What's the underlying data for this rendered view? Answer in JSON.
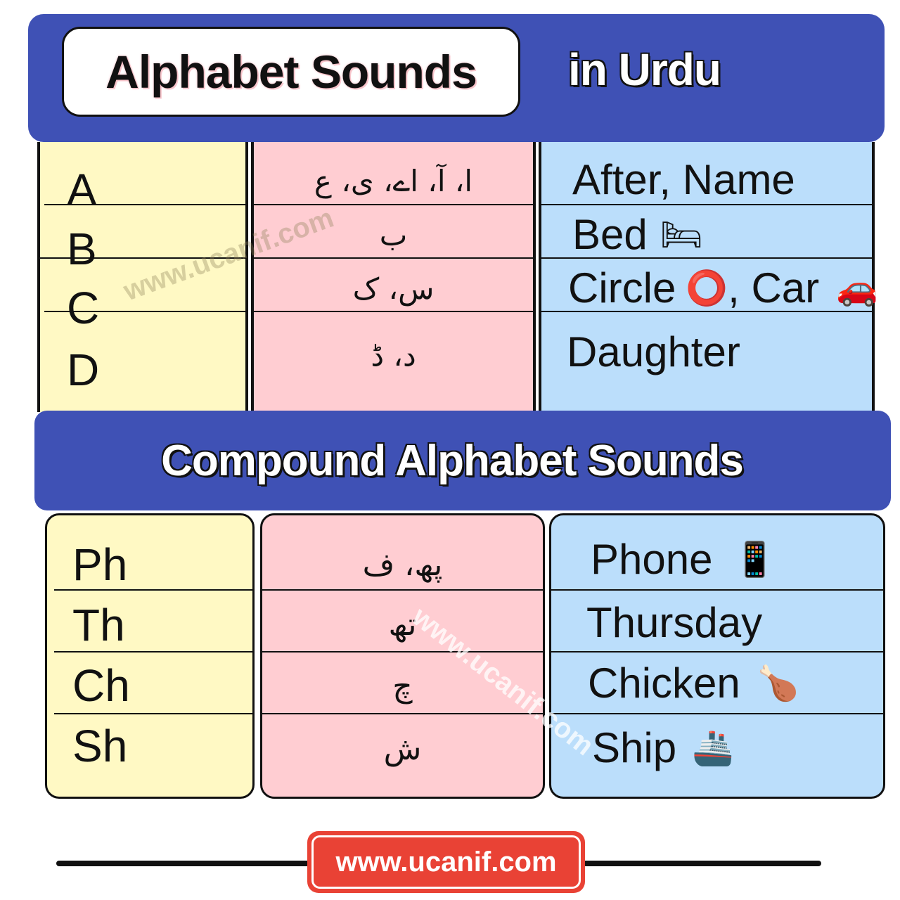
{
  "header": {
    "title": "Alphabet Sounds",
    "subtitle": "in Urdu"
  },
  "basic_sounds": {
    "rows": [
      {
        "letter": "A",
        "urdu": "ا، آ، اے، ی، ع",
        "words": "After, Name",
        "emoji": "",
        "emoji2_word": "",
        "emoji2": ""
      },
      {
        "letter": "B",
        "urdu": "ب",
        "words": "Bed",
        "emoji": "🛏",
        "emoji2_word": "",
        "emoji2": ""
      },
      {
        "letter": "C",
        "urdu": "س، ک",
        "words": "Circle",
        "emoji": "⭕",
        "emoji2_word": ", Car",
        "emoji2": "🚗"
      },
      {
        "letter": "D",
        "urdu": "د، ڈ",
        "words": "Daughter",
        "emoji": "",
        "emoji2_word": "",
        "emoji2": ""
      }
    ]
  },
  "compound_section": {
    "title": "Compound Alphabet Sounds",
    "rows": [
      {
        "letter": "Ph",
        "urdu": "پھ، ف",
        "words": "Phone",
        "emoji": "📱"
      },
      {
        "letter": "Th",
        "urdu": "تھ",
        "words": "Thursday",
        "emoji": ""
      },
      {
        "letter": "Ch",
        "urdu": "چ",
        "words": "Chicken",
        "emoji": "🍗"
      },
      {
        "letter": "Sh",
        "urdu": "ش",
        "words": "Ship",
        "emoji": "🚢"
      }
    ]
  },
  "watermark": "www.ucanif.com",
  "footer": {
    "url": "www.ucanif.com"
  },
  "colors": {
    "banner": "#3f51b5",
    "yellow_col": "#fff9c4",
    "pink_col": "#ffcdd2",
    "blue_col": "#bbdefb",
    "footer_badge": "#e94235"
  }
}
